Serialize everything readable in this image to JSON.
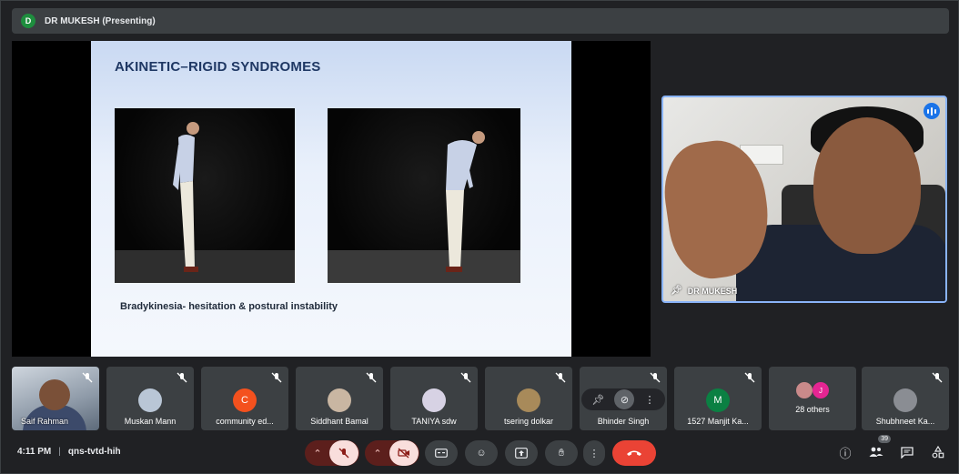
{
  "header": {
    "avatar_initial": "D",
    "title": "DR MUKESH (Presenting)"
  },
  "slide": {
    "title": "AKINETIC–RIGID SYNDROMES",
    "caption": "Bradykinesia- hesitation & postural instability"
  },
  "speaker": {
    "name": "DR MUKESH"
  },
  "participants": [
    {
      "name": "Saif Rahman",
      "kind": "video"
    },
    {
      "name": "Muskan Mann",
      "kind": "photo",
      "color": "#b9c6d6"
    },
    {
      "name": "community ed...",
      "kind": "initial",
      "initial": "C",
      "color": "#f4511e"
    },
    {
      "name": "Siddhant Bamal",
      "kind": "photo",
      "color": "#c9b6a2"
    },
    {
      "name": "TANIYA sdw",
      "kind": "photo",
      "color": "#d7d2e4"
    },
    {
      "name": "tsering dolkar",
      "kind": "photo",
      "color": "#a88a5a"
    },
    {
      "name": "Bhinder Singh",
      "kind": "hover"
    },
    {
      "name": "1527 Manjit Ka...",
      "kind": "initial",
      "initial": "M",
      "color": "#0b8043"
    },
    {
      "name": "28 others",
      "kind": "others",
      "initial": "J",
      "color": "#e52592"
    },
    {
      "name": "Shubhneet Ka...",
      "kind": "photo",
      "color": "#8a8d93"
    }
  ],
  "footer": {
    "time": "4:11 PM",
    "separator": "|",
    "meeting_code": "qns-tvtd-hih",
    "people_count": "39"
  },
  "colors": {
    "accent": "#8ab4f8",
    "end_call": "#ea4335",
    "muted_bg": "#f9dedc"
  }
}
